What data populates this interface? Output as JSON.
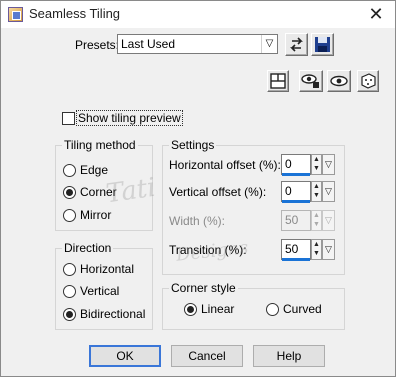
{
  "window": {
    "title": "Seamless Tiling"
  },
  "presets": {
    "label": "Presets:",
    "selected": "Last Used"
  },
  "preview": {
    "show_tiling_label": "Show tiling preview",
    "checked": false
  },
  "tiling_method": {
    "title": "Tiling method",
    "options": [
      {
        "label": "Edge",
        "selected": false
      },
      {
        "label": "Corner",
        "selected": true
      },
      {
        "label": "Mirror",
        "selected": false
      }
    ]
  },
  "direction": {
    "title": "Direction",
    "options": [
      {
        "label": "Horizontal",
        "selected": false
      },
      {
        "label": "Vertical",
        "selected": false
      },
      {
        "label": "Bidirectional",
        "selected": true
      }
    ]
  },
  "settings": {
    "title": "Settings",
    "horizontal_offset": {
      "label": "Horizontal offset (%):",
      "value": "0"
    },
    "vertical_offset": {
      "label": "Vertical offset (%):",
      "value": "0"
    },
    "width": {
      "label": "Width (%):",
      "value": "50",
      "disabled": true
    },
    "transition": {
      "label": "Transition (%):",
      "value": "50"
    }
  },
  "corner_style": {
    "title": "Corner style",
    "options": [
      {
        "label": "Linear",
        "selected": true
      },
      {
        "label": "Curved",
        "selected": false
      }
    ]
  },
  "buttons": {
    "ok": "OK",
    "cancel": "Cancel",
    "help": "Help"
  },
  "watermark": {
    "text1": "Tati",
    "text2": "Designs"
  }
}
